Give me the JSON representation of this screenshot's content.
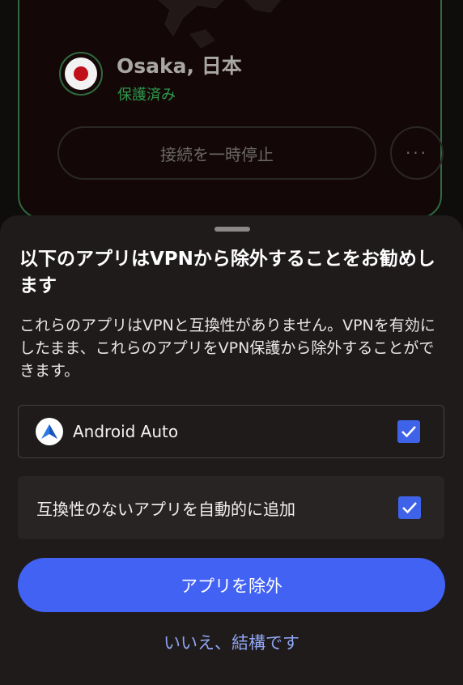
{
  "background_card": {
    "location_name": "Osaka, 日本",
    "location_status": "保護済み",
    "pause_button_label": "接続を一時停止",
    "more_button_label": "···",
    "status_color": "#2d9a4b",
    "flag_icon": "japan-flag-icon"
  },
  "sheet": {
    "title": "以下のアプリはVPNから除外することをお勧めします",
    "description": "これらのアプリはVPNと互換性がありません。VPNを有効にしたまま、これらのアプリをVPN保護から除外することができます。",
    "apps": [
      {
        "name": "Android Auto",
        "icon": "android-auto-icon",
        "checked": true
      }
    ],
    "auto_add": {
      "label": "互換性のないアプリを自動的に追加",
      "checked": true
    },
    "primary_button_label": "アプリを除外",
    "secondary_button_label": "いいえ、結構です",
    "accent_color": "#4262f4"
  }
}
